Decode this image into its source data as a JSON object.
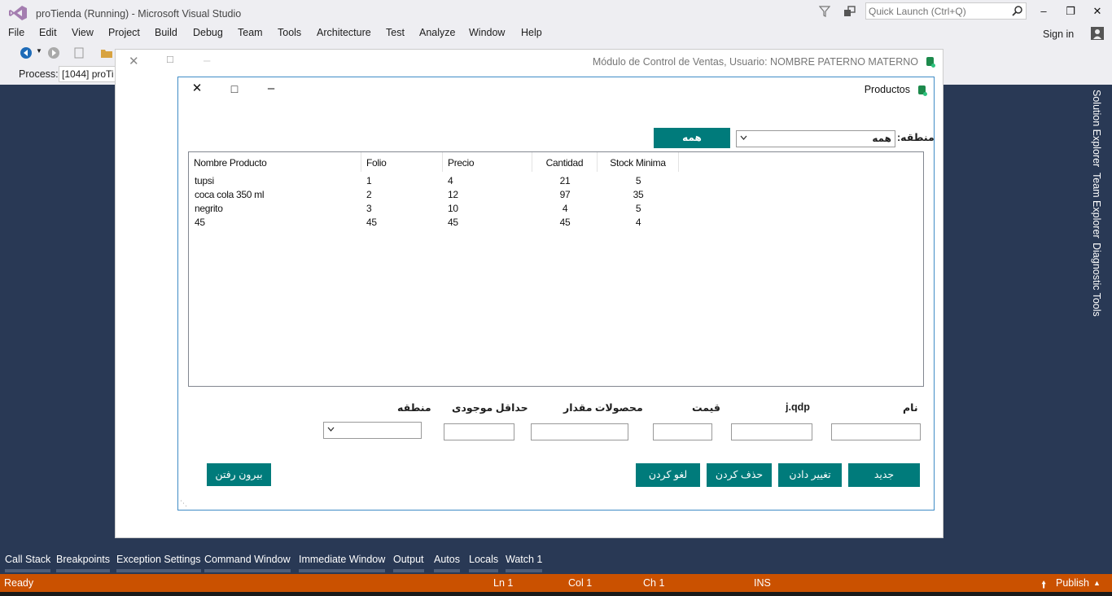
{
  "vs": {
    "title": "proTienda (Running) - Microsoft Visual Studio",
    "quick_launch_placeholder": "Quick Launch (Ctrl+Q)",
    "menu": [
      "File",
      "Edit",
      "View",
      "Project",
      "Build",
      "Debug",
      "Team",
      "Tools",
      "Architecture",
      "Test",
      "Analyze",
      "Window",
      "Help"
    ],
    "sign_in": "Sign in",
    "process_label": "Process:",
    "process_value": "[1044] proTi",
    "side_tabs": [
      "Solution Explorer",
      "Team Explorer",
      "Diagnostic Tools"
    ],
    "bottom_tabs": [
      "Call Stack",
      "Breakpoints",
      "Exception Settings",
      "Command Window",
      "Immediate Window",
      "Output",
      "Autos",
      "Locals",
      "Watch 1"
    ],
    "status": {
      "ready": "Ready",
      "ln": "Ln 1",
      "col": "Col 1",
      "ch": "Ch 1",
      "ins": "INS",
      "publish": "Publish"
    },
    "colors": {
      "accent": "#ca5100",
      "background": "#293955",
      "teal": "#007b7b"
    }
  },
  "mdi": {
    "title": "Módulo de Control de Ventas, Usuario: NOMBRE PATERNO MATERNO"
  },
  "form": {
    "title": "Productos",
    "region_label": "منطقه:",
    "region_value": "همه",
    "all_button": "همه",
    "columns": [
      "Nombre Producto",
      "Folio",
      "Precio",
      "Cantidad",
      "Stock Minima"
    ],
    "rows": [
      [
        "tupsi",
        "1",
        "4",
        "21",
        "5"
      ],
      [
        "coca cola 350 ml",
        "2",
        "12",
        "97",
        "35"
      ],
      [
        "negrito",
        "3",
        "10",
        "4",
        "5"
      ],
      [
        "45",
        "45",
        "45",
        "45",
        "4"
      ]
    ],
    "field_labels": {
      "name": "نام",
      "code": "j.qdp",
      "price": "قیمت",
      "quantity": "محصولات مقدار",
      "min_stock": "حداقل موجودی",
      "region": "منطقه"
    },
    "buttons": {
      "new": "جدید",
      "edit": "تغییر دادن",
      "delete": "حذف کردن",
      "cancel": "لغو کردن",
      "exit": "بیرون رفتن"
    }
  }
}
